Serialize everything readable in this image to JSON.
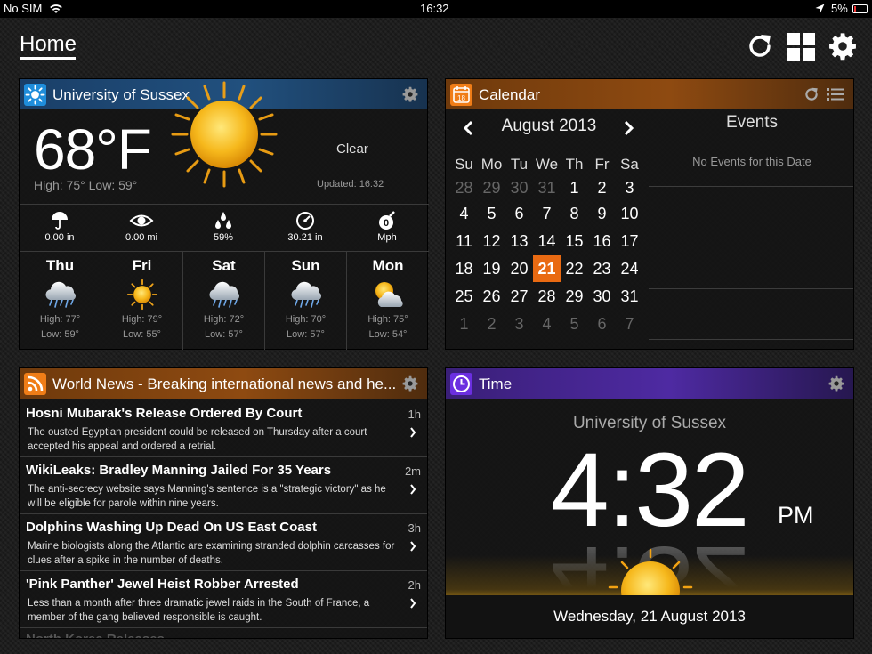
{
  "status_bar": {
    "carrier": "No SIM",
    "time": "16:32",
    "battery": "5%"
  },
  "page": {
    "title": "Home"
  },
  "toolbar": {
    "icons": [
      "refresh-icon",
      "grid-icon",
      "settings-gear-icon"
    ]
  },
  "weather": {
    "location": "University of Sussex",
    "temperature": "68°F",
    "high_low": "High: 75° Low: 59°",
    "condition": "Clear",
    "updated": "Updated: 16:32",
    "stats": [
      {
        "icon": "umbrella-icon",
        "value": "0.00 in"
      },
      {
        "icon": "eye-icon",
        "value": "0.00 mi"
      },
      {
        "icon": "humidity-drops-icon",
        "value": "59%"
      },
      {
        "icon": "pressure-gauge-icon",
        "value": "30.21 in"
      },
      {
        "icon": "wind-icon",
        "value": "Mph"
      }
    ],
    "forecast": [
      {
        "day": "Thu",
        "icon": "rain-cloud-icon",
        "high": "High: 77°",
        "low": "Low: 59°"
      },
      {
        "day": "Fri",
        "icon": "sun-icon",
        "high": "High: 79°",
        "low": "Low: 55°"
      },
      {
        "day": "Sat",
        "icon": "rain-cloud-icon",
        "high": "High: 72°",
        "low": "Low: 57°"
      },
      {
        "day": "Sun",
        "icon": "rain-cloud-icon",
        "high": "High: 70°",
        "low": "Low: 57°"
      },
      {
        "day": "Mon",
        "icon": "partly-cloudy-icon",
        "high": "High: 75°",
        "low": "Low: 54°"
      }
    ]
  },
  "calendar": {
    "title": "Calendar",
    "icon_day": "18",
    "month": "August 2013",
    "weekdays": [
      "Su",
      "Mo",
      "Tu",
      "We",
      "Th",
      "Fr",
      "Sa"
    ],
    "weeks": [
      [
        "28",
        "29",
        "30",
        "31",
        "1",
        "2",
        "3"
      ],
      [
        "4",
        "5",
        "6",
        "7",
        "8",
        "9",
        "10"
      ],
      [
        "11",
        "12",
        "13",
        "14",
        "15",
        "16",
        "17"
      ],
      [
        "18",
        "19",
        "20",
        "21",
        "22",
        "23",
        "24"
      ],
      [
        "25",
        "26",
        "27",
        "28",
        "29",
        "30",
        "31"
      ],
      [
        "1",
        "2",
        "3",
        "4",
        "5",
        "6",
        "7"
      ]
    ],
    "today": "21",
    "events_title": "Events",
    "no_events": "No Events for this Date"
  },
  "news": {
    "title": "World News - Breaking international news and he...",
    "items": [
      {
        "title": "Hosni Mubarak's Release Ordered By Court",
        "age": "1h",
        "summary": "The ousted Egyptian president could be released on Thursday after a court accepted his appeal and ordered a retrial."
      },
      {
        "title": "WikiLeaks: Bradley Manning Jailed For 35 Years",
        "age": "2m",
        "summary": "The anti-secrecy website says Manning's sentence is a \"strategic victory\" as he will be eligible for parole within nine years."
      },
      {
        "title": "Dolphins Washing Up Dead On US East Coast",
        "age": "3h",
        "summary": "Marine biologists along the Atlantic are examining stranded dolphin carcasses for clues after a spike in the number of deaths."
      },
      {
        "title": "'Pink Panther' Jewel Heist Robber Arrested",
        "age": "2h",
        "summary": "Less than a month after three dramatic jewel raids in the South of France, a member of the gang believed responsible is caught."
      }
    ],
    "partial_item": "North Korea Releases..."
  },
  "time": {
    "title": "Time",
    "location": "University of Sussex",
    "clock": "4:32",
    "ampm": "PM",
    "date": "Wednesday, 21 August 2013"
  },
  "colors": {
    "weather_header": "#21507e",
    "orange_header": "#8e4a11",
    "purple_header": "#4e2aa2",
    "accent_today": "#e96a12",
    "sun": "#f6b81c"
  }
}
